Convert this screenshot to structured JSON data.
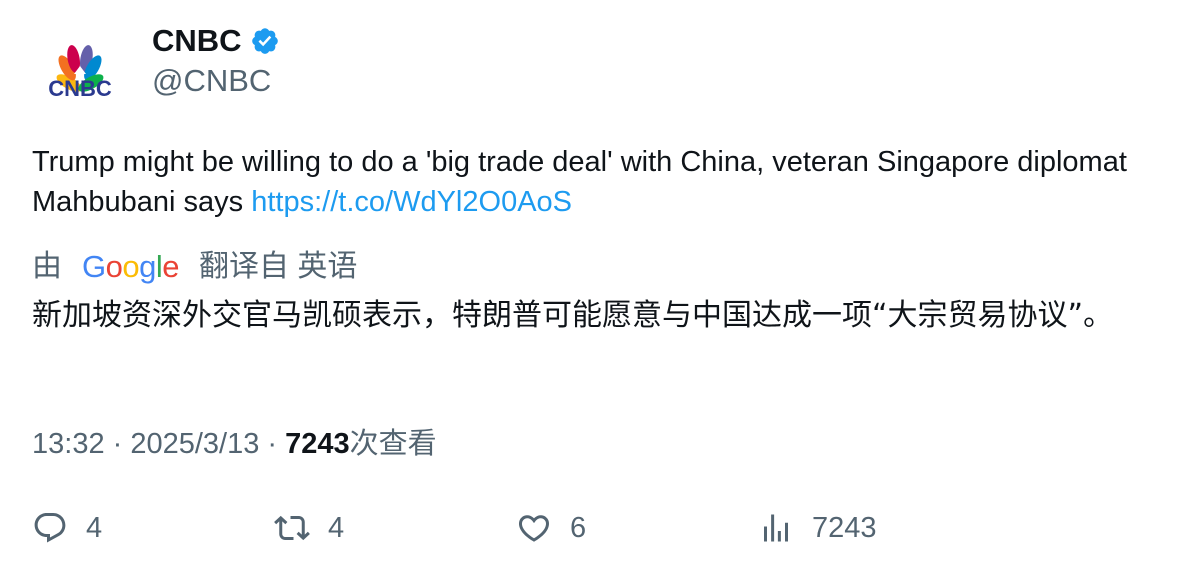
{
  "author": {
    "name": "CNBC",
    "handle": "@CNBC",
    "avatar_label": "CNBC",
    "verified_icon": "verified-badge-icon",
    "brand_colors": [
      "#f37021",
      "#fcb711",
      "#cc004c",
      "#6460aa",
      "#0089d0",
      "#0db14b"
    ]
  },
  "tweet": {
    "text": "Trump might be willing to do a 'big trade deal' with China, veteran Singapore diplomat Mahbubani says ",
    "link": "https://t.co/WdYl2O0AoS"
  },
  "translation": {
    "prefix": "由",
    "provider": "Google",
    "suffix": "翻译自 英语",
    "text": "新加坡资深外交官马凯硕表示，特朗普可能愿意与中国达成一项“大宗贸易协议”。"
  },
  "meta": {
    "time": "13:32",
    "sep1": " · ",
    "date": "2025/3/13",
    "sep2": " · ",
    "views_num": "7243",
    "views_label": "次查看"
  },
  "actions": {
    "reply_count": "4",
    "retweet_count": "4",
    "like_count": "6",
    "views_count": "7243"
  },
  "colors": {
    "link": "#1d9bf0",
    "secondary_text": "#536471",
    "primary_text": "#0f1419",
    "verified": "#1d9bf0"
  }
}
